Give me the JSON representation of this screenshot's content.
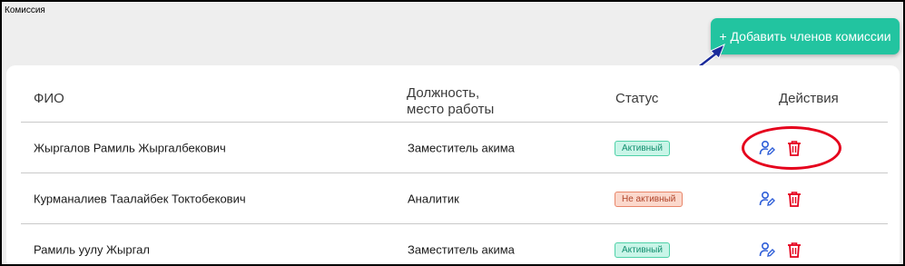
{
  "window": {
    "title": "Комиссия"
  },
  "toolbar": {
    "add_label": "+ Добавить членов комиссии"
  },
  "table": {
    "headers": {
      "name": "ФИО",
      "position_line1": "Должность,",
      "position_line2": "место работы",
      "status": "Статус",
      "actions": "Действия"
    },
    "rows": [
      {
        "name": "Жыргалов Рамиль Жыргалбекович",
        "position": "Заместитель акима",
        "status": "Активный"
      },
      {
        "name": "Курманалиев Таалайбек Токтобекович",
        "position": "Аналитик",
        "status": "Не активный"
      },
      {
        "name": "Рамиль уулу Жыргал",
        "position": "Заместитель акима",
        "status": "Активный"
      }
    ]
  },
  "colors": {
    "accent": "#22c4a0",
    "active_badge": "#c9f5e8",
    "inactive_badge": "#fbd8cc",
    "edit_icon": "#2f5fd8",
    "delete_icon": "#e5001c",
    "highlight_oval": "#e5001c",
    "arrow": "#1a2a9a"
  },
  "icons": {
    "edit": "user-edit-icon",
    "delete": "trash-icon"
  }
}
